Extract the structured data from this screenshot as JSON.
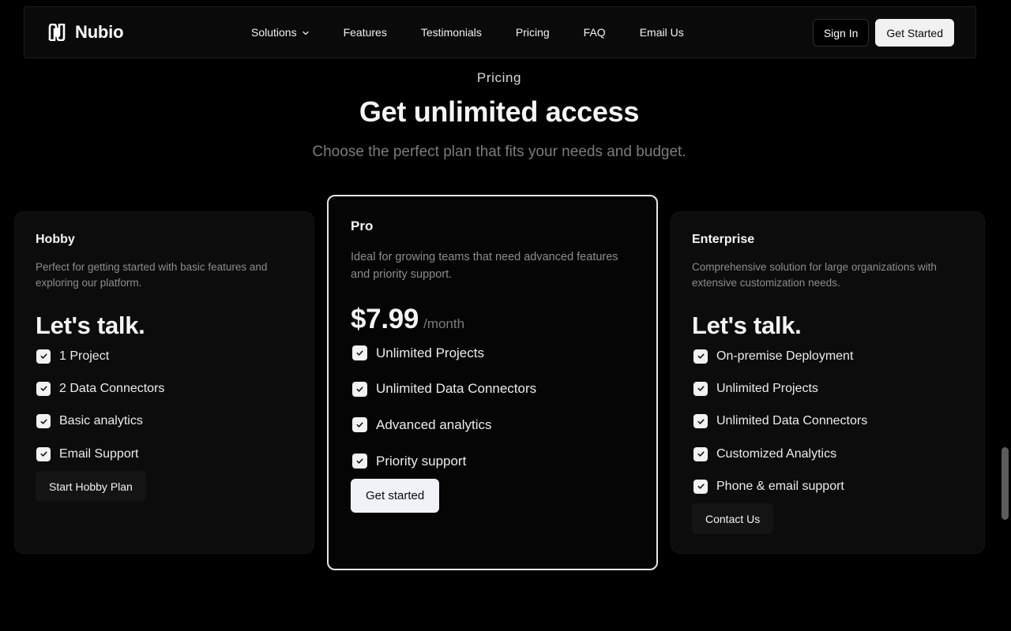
{
  "brand": {
    "name": "Nubio",
    "logo_icon": "nubio-logo-icon"
  },
  "nav": {
    "links": [
      {
        "label": "Solutions",
        "has_dropdown": true
      },
      {
        "label": "Features"
      },
      {
        "label": "Testimonials"
      },
      {
        "label": "Pricing"
      },
      {
        "label": "FAQ"
      },
      {
        "label": "Email Us"
      }
    ],
    "sign_in_label": "Sign In",
    "get_started_label": "Get Started"
  },
  "header": {
    "eyebrow": "Pricing",
    "title": "Get unlimited access",
    "subtitle": "Choose the perfect plan that fits your needs and budget."
  },
  "plans": [
    {
      "name": "Hobby",
      "description": "Perfect for getting started with basic features and exploring our platform.",
      "price": "Let's talk.",
      "features": [
        "1 Project",
        "2 Data Connectors",
        "Basic analytics",
        "Email Support"
      ],
      "cta": "Start Hobby Plan"
    },
    {
      "name": "Pro",
      "description": "Ideal for growing teams that need advanced features and priority support.",
      "price": "$7.99",
      "period": "/month",
      "features": [
        "Unlimited Projects",
        "Unlimited Data Connectors",
        "Advanced analytics",
        "Priority support"
      ],
      "cta": "Get started"
    },
    {
      "name": "Enterprise",
      "description": "Comprehensive solution for large organizations with extensive customization needs.",
      "price": "Let's talk.",
      "features": [
        "On-premise Deployment",
        "Unlimited Projects",
        "Unlimited Data Connectors",
        "Customized Analytics",
        "Phone & email support"
      ],
      "cta": "Contact Us"
    }
  ],
  "colors": {
    "background": "#000000",
    "card": "#0c0c0c",
    "pro_border": "#e6e6e6",
    "muted_text": "#8d8d8d",
    "primary_button": "#f1f1f1"
  }
}
